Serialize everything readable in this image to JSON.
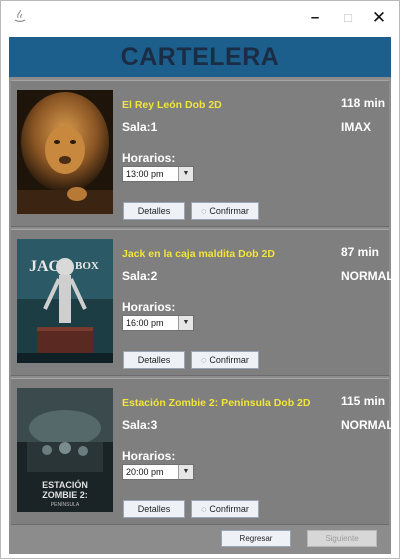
{
  "window": {
    "minimize": "–",
    "maximize": "□",
    "close": "✕"
  },
  "header": {
    "title": "CARTELERA"
  },
  "movies": [
    {
      "title": "El Rey León Dob 2D",
      "duration": "118 min",
      "sala": "Sala:1",
      "format": "IMAX",
      "horarios_label": "Horarios:",
      "selected_time": "13:00 pm",
      "details_label": "Detalles",
      "confirm_label": "Confirmar"
    },
    {
      "title": "Jack en la caja maldita Dob 2D",
      "duration": "87 min",
      "sala": "Sala:2",
      "format": "NORMAL",
      "horarios_label": "Horarios:",
      "selected_time": "16:00 pm",
      "details_label": "Detalles",
      "confirm_label": "Confirmar"
    },
    {
      "title": "Estación Zombie 2: Península Dob 2D",
      "duration": "115 min",
      "sala": "Sala:3",
      "format": "NORMAL",
      "horarios_label": "Horarios:",
      "selected_time": "20:00 pm",
      "details_label": "Detalles",
      "confirm_label": "Confirmar"
    }
  ],
  "footer": {
    "back_label": "Regresar",
    "next_label": "Siguiente"
  }
}
